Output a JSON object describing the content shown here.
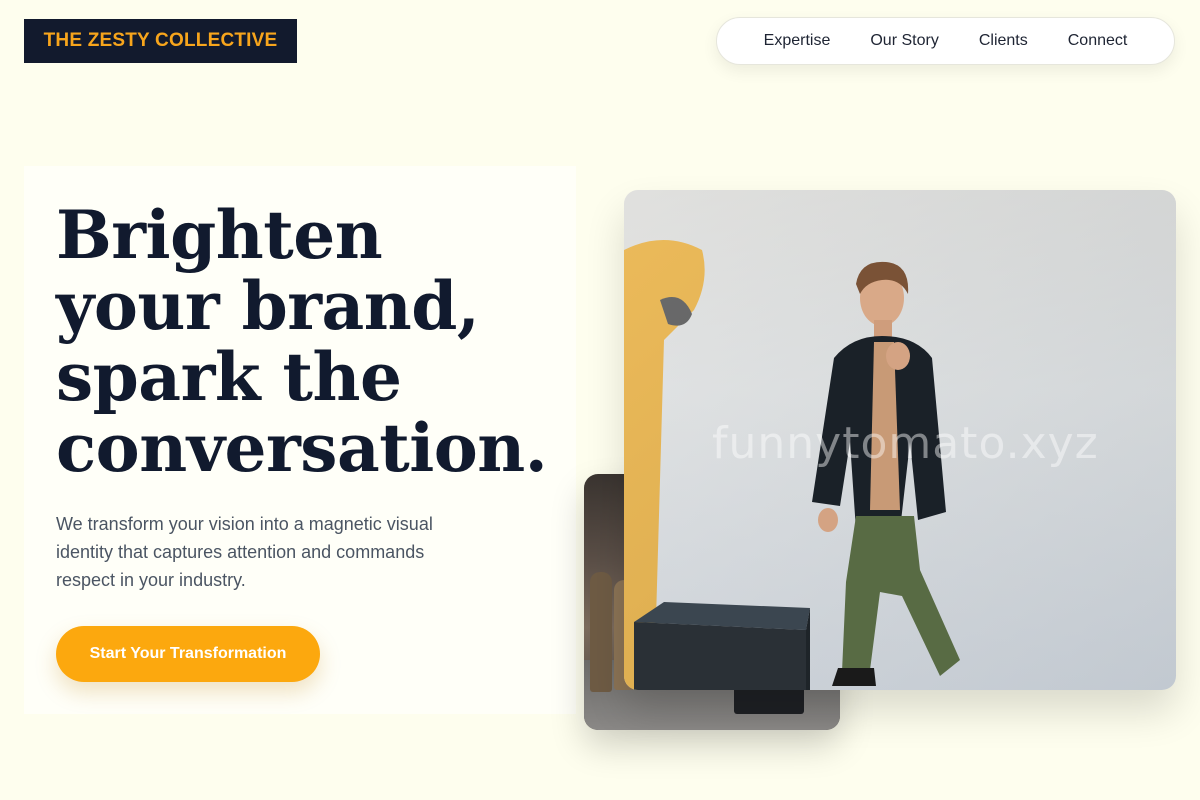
{
  "brand": {
    "logo_text": "THE ZESTY COLLECTIVE"
  },
  "nav": {
    "items": [
      {
        "label": "Expertise"
      },
      {
        "label": "Our Story"
      },
      {
        "label": "Clients"
      },
      {
        "label": "Connect"
      }
    ]
  },
  "hero": {
    "headline": "Brighten your brand, spark the conversation.",
    "lead": "We transform your vision into a magnetic visual identity that captures attention and commands respect in your industry.",
    "cta_label": "Start Your Transformation"
  },
  "media": {
    "watermark_text": "funnytomato.xyz"
  },
  "colors": {
    "background": "#fefeee",
    "brand_dark": "#121a2d",
    "accent": "#fca80e"
  }
}
